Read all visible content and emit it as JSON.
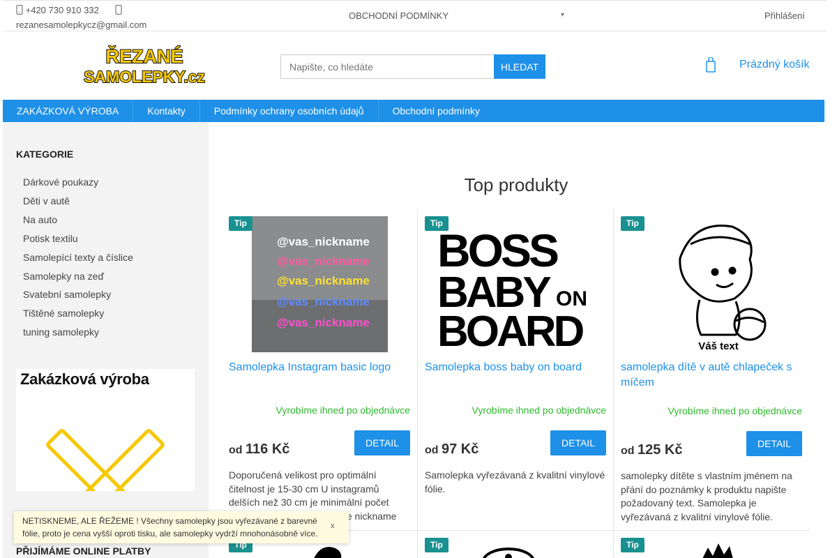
{
  "topbar": {
    "phone": "+420 730 910 332",
    "email": "rezanesamolepkycz@gmail.com",
    "terms_link": "OBCHODNÍ PODMÍNKY",
    "login": "Přihlášení"
  },
  "header": {
    "logo_line1": "ŘEZANÉ",
    "logo_line2": "SAMOLEPKY.cz",
    "search_placeholder": "Napište, co hledáte",
    "search_button": "HLEDAT",
    "cart_label": "Prázdný košík"
  },
  "nav": {
    "items": [
      "ZAKÁZKOVÁ VÝROBA",
      "Kontakty",
      "Podmínky ochrany osobních údajů",
      "Obchodní podmínky"
    ]
  },
  "sidebar": {
    "categories_title": "KATEGORIE",
    "categories": [
      "Dárkové poukazy",
      "Děti v autě",
      "Na auto",
      "Potisk textilu",
      "Samolepící texty a číslice",
      "Samolepky na zeď",
      "Svatební samolepky",
      "Tištěné samolepky",
      "tuning samolepky"
    ],
    "banner_title": "Zakázková výroba",
    "payments_title": "PŘIJÍMÁME ONLINE PLATBY"
  },
  "main": {
    "title": "Top produkty",
    "tip_label": "Tip",
    "price_prefix": "od",
    "detail_label": "DETAIL",
    "products": [
      {
        "name": "Samolepka Instagram basic logo",
        "stock": "Vyrobíme ihned po objednávce",
        "price": "116 Kč",
        "description": "Doporučená velikost pro optimální čitelnost je 15-30 cm  U instagramů delších než 30 cm je minimální počet znaků 10, v případě že máte nickname",
        "image_text": "@vas_nickname"
      },
      {
        "name": "Samolepka boss baby on board",
        "stock": "Vyrobíme ihned po objednávce",
        "price": "97 Kč",
        "description": "Samolepka vyřezávaná z kvalitní vinylové fólie.",
        "image_line1": "BOSS",
        "image_line2": "BABY",
        "image_on": "ON",
        "image_line3": "BOARD"
      },
      {
        "name": "samolepka dítě v autě chlapeček s míčem",
        "stock": "Vyrobíme ihned po objednávce",
        "price": "125 Kč",
        "description": "samolepky dítěte s vlastním jménem na přání do poznámky k produktu napište požadovaný text. Samolepka je vyřezávaná z kvalitní vinylové fólie.",
        "image_caption": "Váš text"
      }
    ]
  },
  "notice": {
    "text": "NETISKNEME, ALE ŘEŽEME ! Všechny samolepky jsou vyřezávané z barevné fólie, proto je cena vyšší oproti tisku, ale samolepky vydrží mnohonásobně více.",
    "close": "x"
  },
  "colors": {
    "accent": "#1e90e8",
    "tip": "#1a9191",
    "stock": "#2eb82e",
    "logo_yellow": "#f6c800"
  }
}
